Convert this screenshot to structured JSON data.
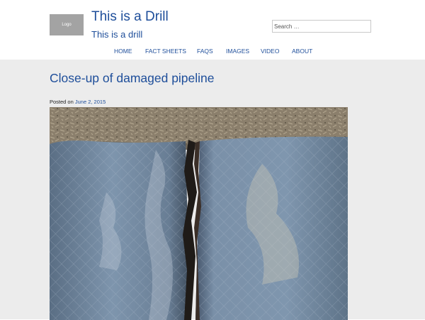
{
  "header": {
    "logo_text": "Logo",
    "site_title": "This is a Drill",
    "tagline": "This is a drill",
    "search_placeholder": "Search …"
  },
  "nav": {
    "items": [
      {
        "label": "HOME"
      },
      {
        "label": "FACT SHEETS"
      },
      {
        "label": "FAQS"
      },
      {
        "label": "IMAGES"
      },
      {
        "label": "VIDEO"
      },
      {
        "label": "ABOUT"
      }
    ]
  },
  "post": {
    "title": "Close-up of damaged pipeline",
    "posted_prefix": "Posted on",
    "date": "June 2, 2015",
    "image_subject": "damaged-pipeline-photo"
  },
  "colors": {
    "link": "#1e4e9a",
    "content_background": "#ececec",
    "logo_background": "#a3a3a3"
  }
}
